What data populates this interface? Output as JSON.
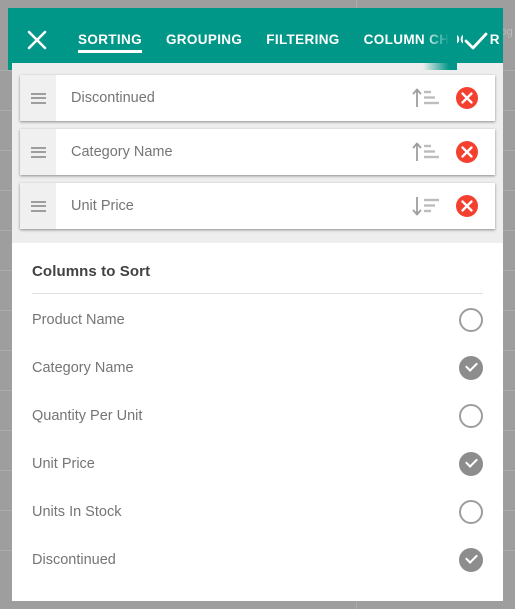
{
  "header": {
    "close_icon": "close-icon",
    "confirm_icon": "check-icon",
    "tabs": [
      {
        "label": "SORTING",
        "active": true
      },
      {
        "label": "GROUPING",
        "active": false
      },
      {
        "label": "FILTERING",
        "active": false
      },
      {
        "label": "COLUMN CHOOSER",
        "active": false
      }
    ]
  },
  "sort_criteria": [
    {
      "label": "Discontinued",
      "direction": "ascending",
      "drag_icon": "drag-handle-icon",
      "remove_icon": "remove-circle-icon"
    },
    {
      "label": "Category Name",
      "direction": "ascending",
      "drag_icon": "drag-handle-icon",
      "remove_icon": "remove-circle-icon"
    },
    {
      "label": "Unit Price",
      "direction": "descending",
      "drag_icon": "drag-handle-icon",
      "remove_icon": "remove-circle-icon"
    }
  ],
  "panel": {
    "title": "Columns to Sort",
    "columns": [
      {
        "label": "Product Name",
        "checked": false
      },
      {
        "label": "Category Name",
        "checked": true
      },
      {
        "label": "Quantity Per Unit",
        "checked": false
      },
      {
        "label": "Unit Price",
        "checked": true
      },
      {
        "label": "Units In Stock",
        "checked": false
      },
      {
        "label": "Discontinued",
        "checked": true
      }
    ]
  },
  "background": {
    "ghost_text": "og"
  },
  "colors": {
    "accent_teal": "#009688",
    "remove_red": "#f44336",
    "checkbox_on": "#8d8d8d",
    "page_backdrop": "#9e9e9e",
    "text_primary": "#424242",
    "text_secondary": "#757575"
  }
}
